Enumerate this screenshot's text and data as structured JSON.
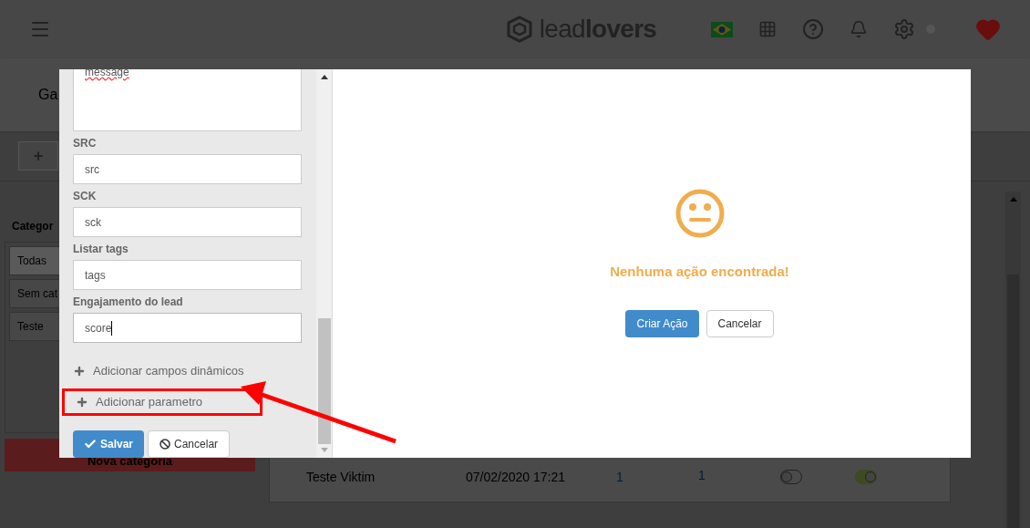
{
  "header": {
    "logo_light": "lead",
    "logo_bold": "lovers"
  },
  "page": {
    "title": "Ga",
    "add_button": "+",
    "categories_title": "Categor",
    "categories": [
      {
        "label": "Todas",
        "selected": true
      },
      {
        "label": "Sem cat",
        "selected": false
      },
      {
        "label": "Teste",
        "selected": false
      }
    ],
    "new_category": "Nova categoria",
    "table_row": {
      "name": "Teste Viktim",
      "date": "07/02/2020 17:21",
      "count_1": "1",
      "count_2": "1",
      "toggles": [
        {
          "on": false
        },
        {
          "on": true
        }
      ]
    }
  },
  "modal": {
    "form": {
      "textarea_value": "message",
      "fields": [
        {
          "label": "SRC",
          "value": "src",
          "focused": false
        },
        {
          "label": "SCK",
          "value": "sck",
          "focused": false
        },
        {
          "label": "Listar tags",
          "value": "tags",
          "focused": false
        },
        {
          "label": "Engajamento do lead",
          "value": "score",
          "focused": true
        }
      ],
      "links": [
        {
          "label": "Adicionar campos dinâmicos",
          "highlighted": false
        },
        {
          "label": "Adicionar parametro",
          "highlighted": true
        }
      ],
      "save": "Salvar",
      "cancel": "Cancelar"
    },
    "empty": {
      "message": "Nenhuma ação encontrada!",
      "create": "Criar Ação",
      "cancel": "Cancelar"
    }
  }
}
